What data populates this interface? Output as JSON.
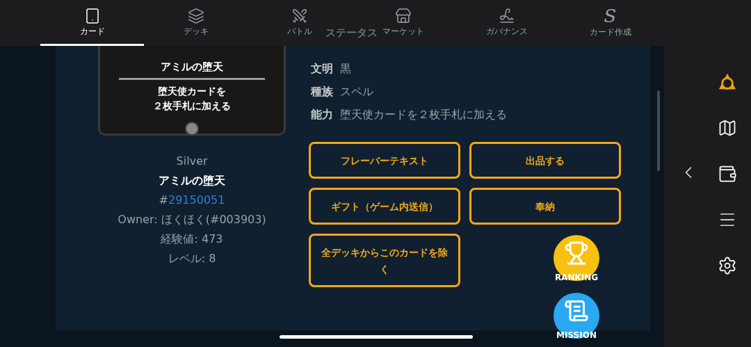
{
  "nav_tabs": [
    {
      "label": "カード",
      "selected": true
    },
    {
      "label": "デッキ",
      "selected": false
    },
    {
      "label": "バトル",
      "selected": false
    },
    {
      "label": "マーケット",
      "selected": false
    },
    {
      "label": "ガバナンス",
      "selected": false
    },
    {
      "label": "カード作成",
      "glyph": "S",
      "selected": false
    }
  ],
  "section_title": "ステータス",
  "card_image": {
    "name": "アミルの堕天",
    "text_lines": [
      "堕天使カードを",
      "２枚手札に加える"
    ]
  },
  "card_info": {
    "rarity": "Silver",
    "name": "アミルの堕天",
    "id_prefix": "#",
    "id": "29150051",
    "owner": "Owner: ほくほく(#003903)",
    "exp": "経験値: 473",
    "level": "レベル: 8"
  },
  "status": [
    {
      "label": "文明",
      "value": "黒"
    },
    {
      "label": "種族",
      "value": "スペル"
    },
    {
      "label": "能力",
      "value": "堕天使カードを２枚手札に加える"
    }
  ],
  "actions": [
    {
      "label": "フレーバーテキスト"
    },
    {
      "label": "出品する"
    },
    {
      "label": "ギフト（ゲーム内送信）"
    },
    {
      "label": "奉納"
    },
    {
      "label": "全デッキからこのカードを除く"
    }
  ],
  "floating_buttons": [
    {
      "kind": "ranking",
      "label": "RANKING"
    },
    {
      "kind": "mission",
      "label": "MISSION"
    }
  ]
}
